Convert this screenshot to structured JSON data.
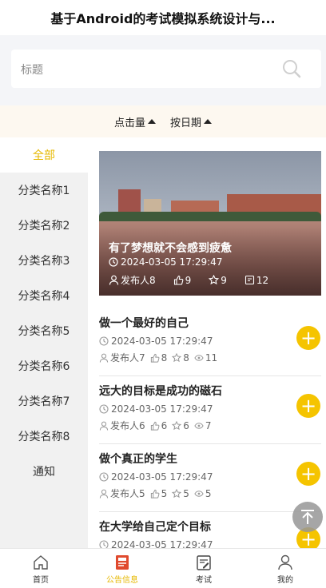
{
  "header": {
    "title": "基于Android的考试模拟系统设计与..."
  },
  "search": {
    "placeholder": "标题"
  },
  "sort": {
    "by_clicks": "点击量",
    "by_date": "按日期"
  },
  "sidebar": {
    "items": [
      {
        "label": "全部",
        "active": true
      },
      {
        "label": "分类名称1"
      },
      {
        "label": "分类名称2"
      },
      {
        "label": "分类名称3"
      },
      {
        "label": "分类名称4"
      },
      {
        "label": "分类名称5"
      },
      {
        "label": "分类名称6"
      },
      {
        "label": "分类名称7"
      },
      {
        "label": "分类名称8"
      },
      {
        "label": "通知"
      }
    ]
  },
  "featured": {
    "title": "有了梦想就不会感到疲惫",
    "date": "2024-03-05 17:29:47",
    "author": "发布人8",
    "likes": "9",
    "favorites": "9",
    "views": "12"
  },
  "articles": [
    {
      "title": "做一个最好的自己",
      "date": "2024-03-05 17:29:47",
      "author": "发布人7",
      "likes": "8",
      "favorites": "8",
      "views": "11"
    },
    {
      "title": "远大的目标是成功的磁石",
      "date": "2024-03-05 17:29:47",
      "author": "发布人6",
      "likes": "6",
      "favorites": "6",
      "views": "7"
    },
    {
      "title": "做个真正的学生",
      "date": "2024-03-05 17:29:47",
      "author": "发布人5",
      "likes": "5",
      "favorites": "5",
      "views": "5"
    },
    {
      "title": "在大学给自己定个目标",
      "date": "2024-03-05 17:29:47",
      "author": "",
      "likes": "",
      "favorites": "",
      "views": ""
    }
  ],
  "tabbar": {
    "items": [
      {
        "label": "首页",
        "icon": "home-icon"
      },
      {
        "label": "公告信息",
        "icon": "notice-icon",
        "active": true
      },
      {
        "label": "考试",
        "icon": "exam-icon"
      },
      {
        "label": "我的",
        "icon": "user-icon"
      }
    ]
  },
  "colors": {
    "accent": "#e6b800",
    "plus_button": "#f5c400",
    "sidebar_bg": "#f1f1f1"
  }
}
